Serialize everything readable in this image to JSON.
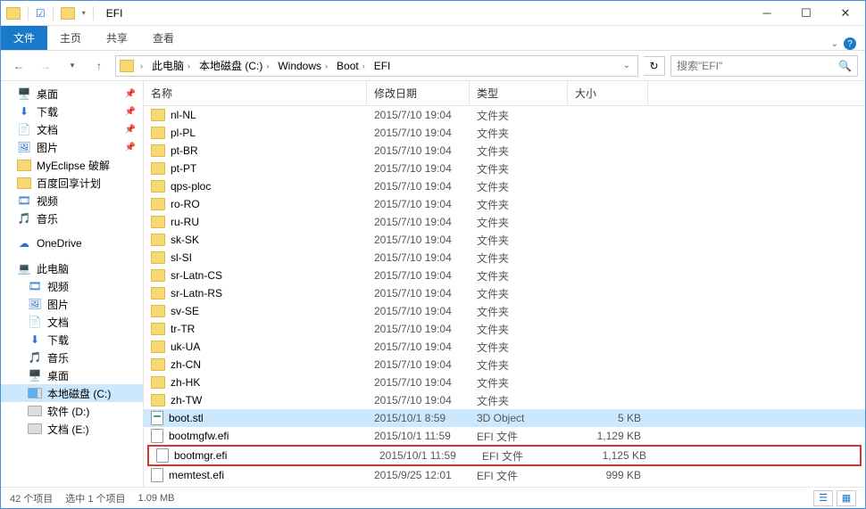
{
  "window": {
    "title": "EFI"
  },
  "ribbon": {
    "tabs": {
      "file": "文件",
      "home": "主页",
      "share": "共享",
      "view": "查看"
    }
  },
  "breadcrumbs": {
    "items": [
      {
        "label": "此电脑"
      },
      {
        "label": "本地磁盘 (C:)"
      },
      {
        "label": "Windows"
      },
      {
        "label": "Boot"
      },
      {
        "label": "EFI"
      }
    ]
  },
  "search": {
    "placeholder": "搜索\"EFI\""
  },
  "sidebar": [
    {
      "label": "桌面",
      "type": "qa",
      "icon": "desktop",
      "pin": true
    },
    {
      "label": "下载",
      "type": "qa",
      "icon": "download",
      "pin": true
    },
    {
      "label": "文档",
      "type": "qa",
      "icon": "doc",
      "pin": true
    },
    {
      "label": "图片",
      "type": "qa",
      "icon": "pic",
      "pin": true
    },
    {
      "label": "MyEclipse 破解",
      "type": "qa",
      "icon": "folder"
    },
    {
      "label": "百度回享计划",
      "type": "qa",
      "icon": "folder"
    },
    {
      "label": "视频",
      "type": "qa",
      "icon": "video"
    },
    {
      "label": "音乐",
      "type": "qa",
      "icon": "music"
    },
    {
      "sep": true
    },
    {
      "label": "OneDrive",
      "type": "section",
      "icon": "onedrive"
    },
    {
      "sep": true
    },
    {
      "label": "此电脑",
      "type": "section",
      "icon": "pc"
    },
    {
      "label": "视频",
      "type": "lib",
      "icon": "video"
    },
    {
      "label": "图片",
      "type": "lib",
      "icon": "pic"
    },
    {
      "label": "文档",
      "type": "lib",
      "icon": "doc"
    },
    {
      "label": "下载",
      "type": "lib",
      "icon": "download"
    },
    {
      "label": "音乐",
      "type": "lib",
      "icon": "music"
    },
    {
      "label": "桌面",
      "type": "lib",
      "icon": "desktop"
    },
    {
      "label": "本地磁盘 (C:)",
      "type": "drive",
      "icon": "drive-c",
      "sel": true
    },
    {
      "label": "软件 (D:)",
      "type": "drive",
      "icon": "drive"
    },
    {
      "label": "文档 (E:)",
      "type": "drive",
      "icon": "drive"
    }
  ],
  "columns": {
    "name": "名称",
    "date": "修改日期",
    "type": "类型",
    "size": "大小"
  },
  "files": [
    {
      "name": "nl-NL",
      "date": "2015/7/10 19:04",
      "type": "文件夹",
      "size": "",
      "kind": "folder"
    },
    {
      "name": "pl-PL",
      "date": "2015/7/10 19:04",
      "type": "文件夹",
      "size": "",
      "kind": "folder"
    },
    {
      "name": "pt-BR",
      "date": "2015/7/10 19:04",
      "type": "文件夹",
      "size": "",
      "kind": "folder"
    },
    {
      "name": "pt-PT",
      "date": "2015/7/10 19:04",
      "type": "文件夹",
      "size": "",
      "kind": "folder"
    },
    {
      "name": "qps-ploc",
      "date": "2015/7/10 19:04",
      "type": "文件夹",
      "size": "",
      "kind": "folder"
    },
    {
      "name": "ro-RO",
      "date": "2015/7/10 19:04",
      "type": "文件夹",
      "size": "",
      "kind": "folder"
    },
    {
      "name": "ru-RU",
      "date": "2015/7/10 19:04",
      "type": "文件夹",
      "size": "",
      "kind": "folder"
    },
    {
      "name": "sk-SK",
      "date": "2015/7/10 19:04",
      "type": "文件夹",
      "size": "",
      "kind": "folder"
    },
    {
      "name": "sl-SI",
      "date": "2015/7/10 19:04",
      "type": "文件夹",
      "size": "",
      "kind": "folder"
    },
    {
      "name": "sr-Latn-CS",
      "date": "2015/7/10 19:04",
      "type": "文件夹",
      "size": "",
      "kind": "folder"
    },
    {
      "name": "sr-Latn-RS",
      "date": "2015/7/10 19:04",
      "type": "文件夹",
      "size": "",
      "kind": "folder"
    },
    {
      "name": "sv-SE",
      "date": "2015/7/10 19:04",
      "type": "文件夹",
      "size": "",
      "kind": "folder"
    },
    {
      "name": "tr-TR",
      "date": "2015/7/10 19:04",
      "type": "文件夹",
      "size": "",
      "kind": "folder"
    },
    {
      "name": "uk-UA",
      "date": "2015/7/10 19:04",
      "type": "文件夹",
      "size": "",
      "kind": "folder"
    },
    {
      "name": "zh-CN",
      "date": "2015/7/10 19:04",
      "type": "文件夹",
      "size": "",
      "kind": "folder"
    },
    {
      "name": "zh-HK",
      "date": "2015/7/10 19:04",
      "type": "文件夹",
      "size": "",
      "kind": "folder"
    },
    {
      "name": "zh-TW",
      "date": "2015/7/10 19:04",
      "type": "文件夹",
      "size": "",
      "kind": "folder"
    },
    {
      "name": "boot.stl",
      "date": "2015/10/1 8:59",
      "type": "3D Object",
      "size": "5 KB",
      "kind": "file-blue",
      "sel": true
    },
    {
      "name": "bootmgfw.efi",
      "date": "2015/10/1 11:59",
      "type": "EFI 文件",
      "size": "1,129 KB",
      "kind": "file"
    },
    {
      "name": "bootmgr.efi",
      "date": "2015/10/1 11:59",
      "type": "EFI 文件",
      "size": "1,125 KB",
      "kind": "file",
      "highlight": true
    },
    {
      "name": "memtest.efi",
      "date": "2015/9/25 12:01",
      "type": "EFI 文件",
      "size": "999 KB",
      "kind": "file"
    }
  ],
  "status": {
    "count": "42 个项目",
    "selection": "选中 1 个项目",
    "size": "1.09 MB"
  }
}
